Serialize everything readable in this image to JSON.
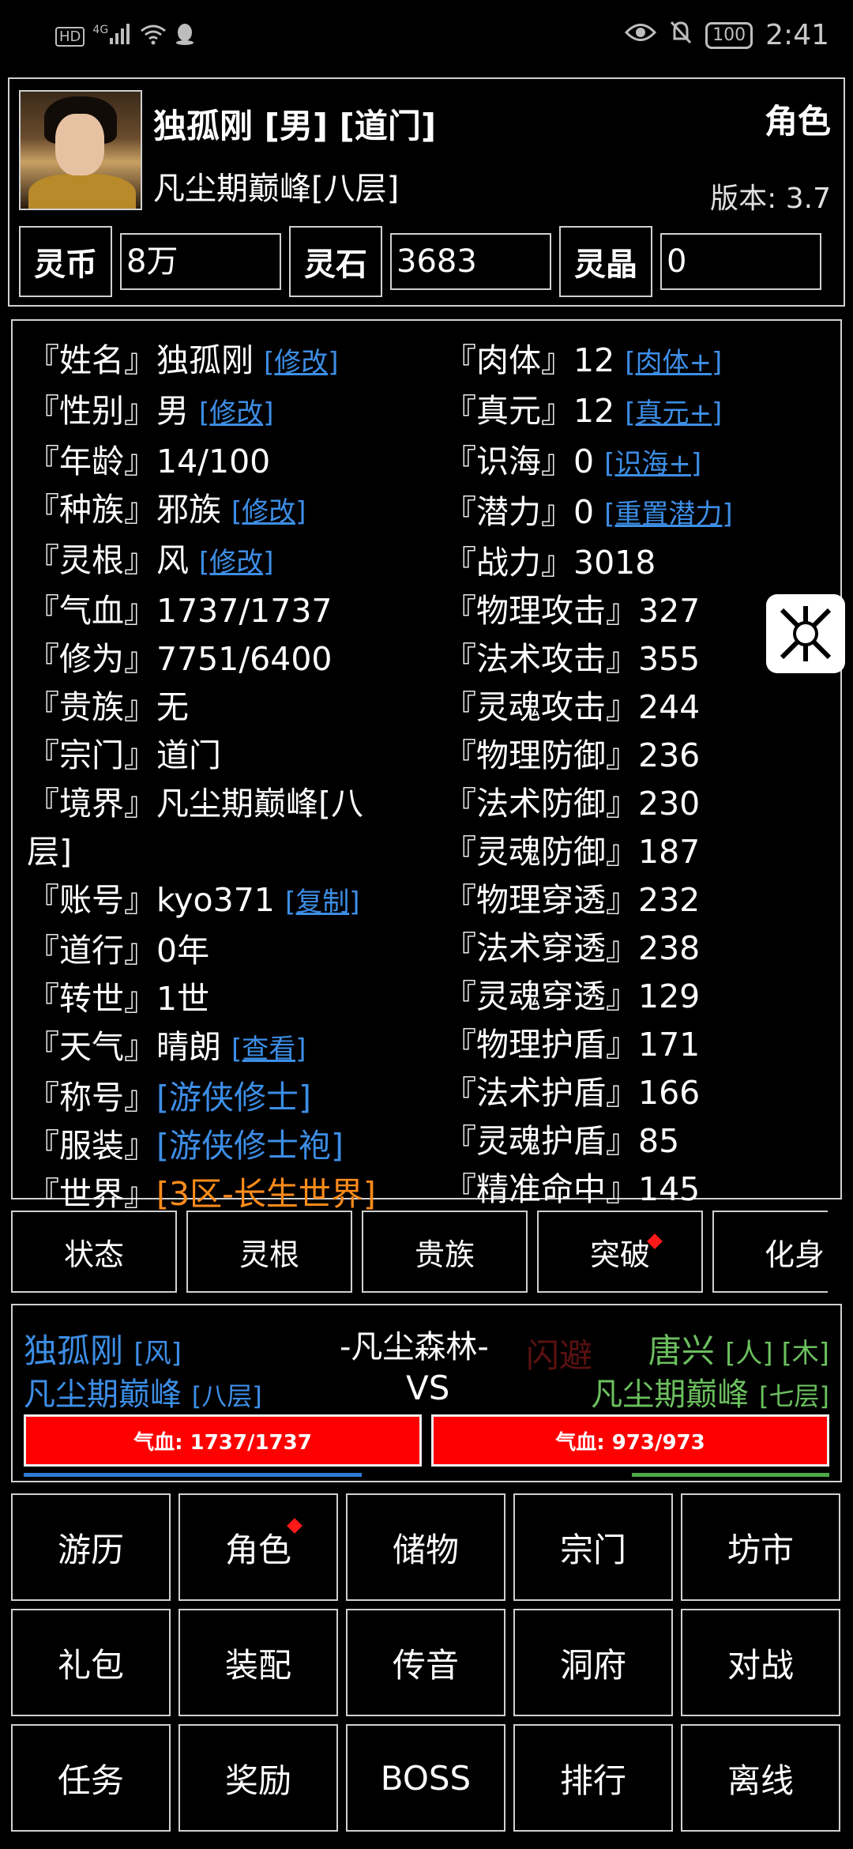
{
  "status_bar": {
    "left_icons": [
      "hd-icon",
      "4g-signal-icon",
      "wifi-icon",
      "qq-icon"
    ],
    "hd": "HD",
    "net": "4G",
    "battery": "100",
    "time": "2:41"
  },
  "header": {
    "name_line": "独孤刚 [男] [道门]",
    "realm_line": "凡尘期巅峰[八层]",
    "title": "角色",
    "version": "版本:  3.7",
    "currencies": [
      {
        "label": "灵币",
        "value": "8万"
      },
      {
        "label": "灵石",
        "value": "3683"
      },
      {
        "label": "灵晶",
        "value": "0"
      }
    ]
  },
  "stats_left": [
    {
      "label": "『姓名』",
      "value": "独孤刚",
      "link": "[修改]"
    },
    {
      "label": "『性别』",
      "value": "男",
      "link": "[修改]"
    },
    {
      "label": "『年龄』",
      "value": "14/100"
    },
    {
      "label": "『种族』",
      "value": "邪族",
      "link": "[修改]"
    },
    {
      "label": "『灵根』",
      "value": "风",
      "link": "[修改]"
    },
    {
      "label": "『气血』",
      "value": "1737/1737"
    },
    {
      "label": "『修为』",
      "value": "7751/6400"
    },
    {
      "label": "『贵族』",
      "value": "无"
    },
    {
      "label": "『宗门』",
      "value": "道门"
    },
    {
      "label": "『境界』",
      "value": "凡尘期巅峰[八层]"
    },
    {
      "label": "『账号』",
      "value": "kyo371",
      "link": "[复制]"
    },
    {
      "label": "『道行』",
      "value": "0年"
    },
    {
      "label": "『转世』",
      "value": "1世"
    },
    {
      "label": "『天气』",
      "value": "晴朗",
      "link": "[查看]"
    },
    {
      "label": "『称号』",
      "value": "[游侠修士]"
    },
    {
      "label": "『服装』",
      "value": "[游侠修士袍]"
    },
    {
      "label": "『世界』",
      "value": "[3区-长生世界]"
    }
  ],
  "stats_right": [
    {
      "label": "『肉体』",
      "value": "12",
      "link": "[肉体+]"
    },
    {
      "label": "『真元』",
      "value": "12",
      "link": "[真元+]"
    },
    {
      "label": "『识海』",
      "value": "0",
      "link": "[识海+]"
    },
    {
      "label": "『潜力』",
      "value": "0",
      "link": "[重置潜力]"
    },
    {
      "label": "『战力』",
      "value": "3018"
    },
    {
      "label": "『物理攻击』",
      "value": "327"
    },
    {
      "label": "『法术攻击』",
      "value": "355"
    },
    {
      "label": "『灵魂攻击』",
      "value": "244"
    },
    {
      "label": "『物理防御』",
      "value": "236"
    },
    {
      "label": "『法术防御』",
      "value": "230"
    },
    {
      "label": "『灵魂防御』",
      "value": "187"
    },
    {
      "label": "『物理穿透』",
      "value": "232"
    },
    {
      "label": "『法术穿透』",
      "value": "238"
    },
    {
      "label": "『灵魂穿透』",
      "value": "129"
    },
    {
      "label": "『物理护盾』",
      "value": "171"
    },
    {
      "label": "『法术护盾』",
      "value": "166"
    },
    {
      "label": "『灵魂护盾』",
      "value": "85"
    },
    {
      "label": "『精准命中』",
      "value": "145"
    }
  ],
  "tabs": [
    "状态",
    "灵根",
    "贵族",
    "突破",
    "化身"
  ],
  "battle": {
    "p1_name": "独孤刚",
    "p1_tag": "[风]",
    "p1_realm": "凡尘期巅峰",
    "p1_layer": "[八层]",
    "location": "-凡尘森林-",
    "dodge": "闪避",
    "vs": "VS",
    "p2_name": "唐兴",
    "p2_tag": "[人] [木]",
    "p2_realm": "凡尘期巅峰",
    "p2_layer": "[七层]",
    "p1_hp": "气血: 1737/1737",
    "p2_hp": "气血: 973/973"
  },
  "menu": [
    "游历",
    "角色",
    "储物",
    "宗门",
    "坊市",
    "礼包",
    "装配",
    "传音",
    "洞府",
    "对战",
    "任务",
    "奖励",
    "BOSS",
    "排行",
    "离线"
  ],
  "float_button_icon": "game-logo-icon",
  "colors": {
    "link": "#3d8ee6",
    "world": "#ff8c1a",
    "enemy": "#6bbf5e",
    "hp": "#ff0000",
    "dot": "#ff1a1a"
  }
}
